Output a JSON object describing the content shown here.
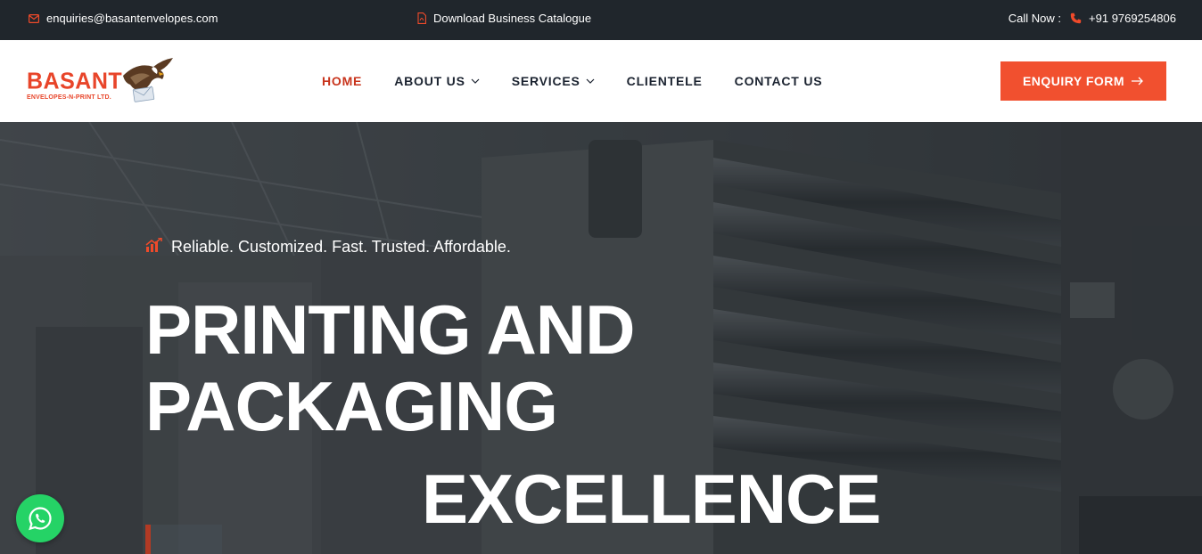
{
  "topbar": {
    "email": "enquiries@basantenvelopes.com",
    "email_icon": "envelope-icon",
    "catalogue": "Download Business Catalogue",
    "catalogue_icon": "pdf-file-icon",
    "call_label": "Call Now :",
    "phone": "+91 9769254806",
    "phone_icon": "phone-icon"
  },
  "logo": {
    "word": "BASANT",
    "sub": "ENVELOPES-N-PRINT LTD."
  },
  "nav": {
    "items": [
      {
        "label": "HOME",
        "active": true
      },
      {
        "label": "ABOUT US",
        "dropdown": true
      },
      {
        "label": "SERVICES",
        "dropdown": true
      },
      {
        "label": "CLIENTELE"
      },
      {
        "label": "CONTACT US"
      }
    ]
  },
  "enquiry": {
    "label": "ENQUIRY FORM",
    "icon": "arrow-right-icon"
  },
  "hero": {
    "tagline": "Reliable. Customized. Fast. Trusted. Affordable.",
    "tagline_icon": "chart-growth-icon",
    "line1": "PRINTING AND",
    "line2": "PACKAGING",
    "line3": "EXCELLENCE"
  },
  "colors": {
    "accent": "#f1502f",
    "topbar_bg": "#20262c",
    "nav_active": "#c8341c",
    "whatsapp": "#25d366"
  },
  "whatsapp": {
    "icon": "whatsapp-icon"
  }
}
